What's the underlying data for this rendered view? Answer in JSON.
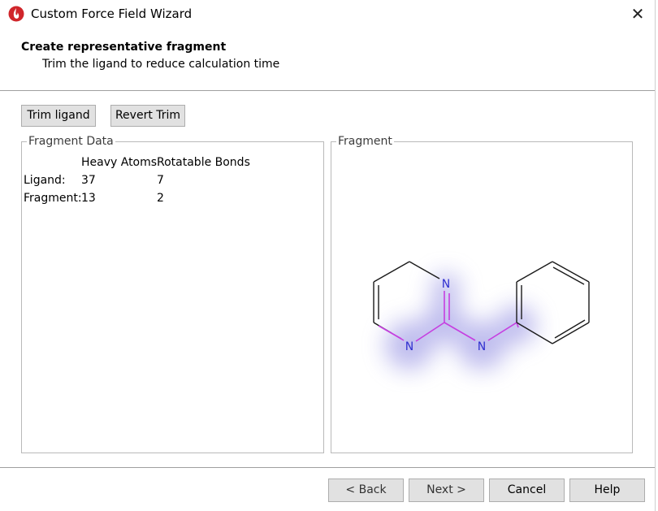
{
  "window": {
    "title": "Custom Force Field Wizard",
    "close_glyph": "✕",
    "icon": "flame-app-icon"
  },
  "header": {
    "title": "Create representative fragment",
    "subtitle": "Trim the ligand to reduce calculation time"
  },
  "toolbar": {
    "trim_label": "Trim ligand",
    "revert_label": "Revert Trim"
  },
  "fragment_data": {
    "legend": "Fragment Data",
    "columns": [
      "Heavy Atoms",
      "Rotatable Bonds"
    ],
    "rows": [
      {
        "label": "Ligand:",
        "heavy_atoms": "37",
        "rotatable_bonds": "7"
      },
      {
        "label": "Fragment:",
        "heavy_atoms": "13",
        "rotatable_bonds": "2"
      }
    ]
  },
  "fragment_view": {
    "legend": "Fragment",
    "atom_labels": [
      "N",
      "N",
      "N"
    ],
    "colors": {
      "bond": "#1a1a1a",
      "highlight_bond": "#c63fe0",
      "nitrogen": "#3030d0",
      "glow": "#8a86e0"
    }
  },
  "footer": {
    "back_label": "< Back",
    "next_label": "Next >",
    "cancel_label": "Cancel",
    "help_label": "Help"
  }
}
